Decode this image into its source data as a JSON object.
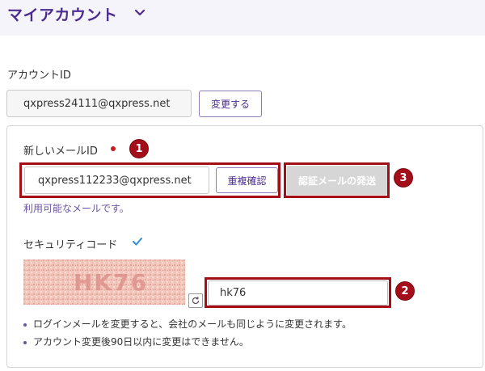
{
  "header": {
    "title": "マイアカウント"
  },
  "account": {
    "label": "アカウントID",
    "value": "qxpress24111@qxpress.net",
    "change_label": "変更する"
  },
  "new_mail": {
    "label": "新しいメールID",
    "value": "qxpress112233@qxpress.net",
    "dup_check_label": "重複確認",
    "verify_label": "認証メールの発送",
    "available_msg": "利用可能なメールです。"
  },
  "security": {
    "label": "セキュリティコード",
    "captcha_text": "HK76",
    "code_value": "hk76"
  },
  "notes": [
    "ログインメールを変更すると、会社のメールも同じように変更されます。",
    "アカウント変更後90日以内に変更はできません。"
  ],
  "callouts": [
    "1",
    "2",
    "3"
  ],
  "colors": {
    "brand": "#4b2c8f",
    "highlight": "#a50d17",
    "callout": "#a40e1a",
    "disabled_button": "#d6d6d6"
  }
}
